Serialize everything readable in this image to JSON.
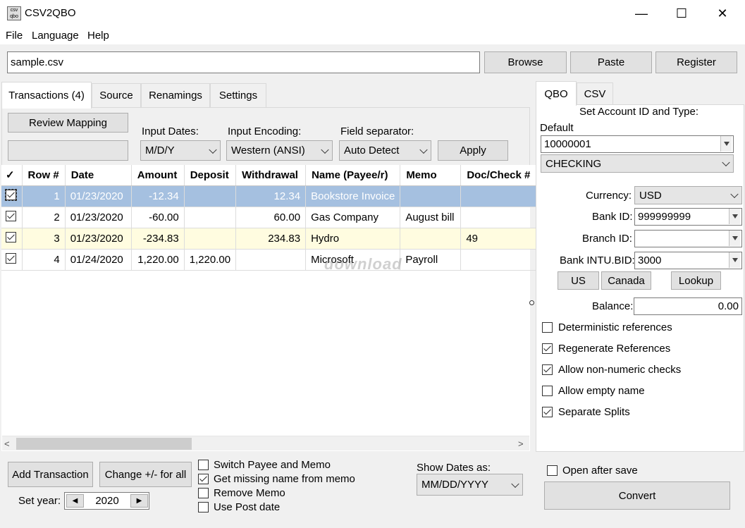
{
  "window": {
    "title": "CSV2QBO",
    "minimize": "—",
    "maximize": "☐",
    "close": "✕"
  },
  "menu": [
    "File",
    "Language",
    "Help"
  ],
  "file_path": "sample.csv",
  "toolbar": {
    "browse": "Browse",
    "paste": "Paste",
    "register": "Register"
  },
  "left_tabs": [
    "Transactions (4)",
    "Source",
    "Renamings",
    "Settings"
  ],
  "mapping": {
    "review_button": "Review Mapping",
    "mapping_select": "",
    "input_dates_label": "Input Dates:",
    "input_dates_value": "M/D/Y",
    "input_encoding_label": "Input Encoding:",
    "input_encoding_value": "Western (ANSI)",
    "field_separator_label": "Field separator:",
    "field_separator_value": "Auto Detect",
    "apply_button": "Apply"
  },
  "grid": {
    "headers": [
      "✓",
      "Row #",
      "Date",
      "Amount",
      "Deposit",
      "Withdrawal",
      "Name (Payee/r)",
      "Memo",
      "Doc/Check #"
    ],
    "rows": [
      {
        "checked": true,
        "row": "1",
        "date": "01/23/2020",
        "amount": "-12.34",
        "deposit": "",
        "withdrawal": "12.34",
        "name": "Bookstore Invoice",
        "memo": "",
        "doc": ""
      },
      {
        "checked": true,
        "row": "2",
        "date": "01/23/2020",
        "amount": "-60.00",
        "deposit": "",
        "withdrawal": "60.00",
        "name": "Gas Company",
        "memo": "August bill",
        "doc": ""
      },
      {
        "checked": true,
        "row": "3",
        "date": "01/23/2020",
        "amount": "-234.83",
        "deposit": "",
        "withdrawal": "234.83",
        "name": "Hydro",
        "memo": "",
        "doc": "49"
      },
      {
        "checked": true,
        "row": "4",
        "date": "01/24/2020",
        "amount": "1,220.00",
        "deposit": "1,220.00",
        "withdrawal": "",
        "name": "Microsoft",
        "memo": "Payroll",
        "doc": ""
      }
    ]
  },
  "bottom": {
    "add_transaction": "Add Transaction",
    "change_sign": "Change +/- for all",
    "set_year_label": "Set year:",
    "year_value": "2020",
    "options": [
      {
        "label": "Switch Payee and Memo",
        "checked": false
      },
      {
        "label": "Get missing name from memo",
        "checked": true
      },
      {
        "label": "Remove Memo",
        "checked": false
      },
      {
        "label": "Use Post date",
        "checked": false
      }
    ],
    "show_dates_label": "Show Dates as:",
    "show_dates_value": "MM/DD/YYYY"
  },
  "right_tabs": [
    "QBO",
    "CSV"
  ],
  "qbo": {
    "set_account_label": "Set Account ID and Type:",
    "default_label": "Default",
    "account_id": "10000001",
    "account_type": "CHECKING",
    "currency_label": "Currency:",
    "currency_value": "USD",
    "bank_id_label": "Bank ID:",
    "bank_id_value": "999999999",
    "branch_id_label": "Branch ID:",
    "branch_id_value": "",
    "bank_intu_label": "Bank INTU.BID:",
    "bank_intu_value": "3000",
    "us_button": "US",
    "canada_button": "Canada",
    "lookup_button": "Lookup",
    "balance_label": "Balance:",
    "balance_value": "0.00",
    "options": [
      {
        "label": "Deterministic references",
        "checked": false
      },
      {
        "label": "Regenerate References",
        "checked": true
      },
      {
        "label": "Allow non-numeric checks",
        "checked": true
      },
      {
        "label": "Allow empty name",
        "checked": false
      },
      {
        "label": "Separate Splits",
        "checked": true
      }
    ],
    "open_after_save_label": "Open after save",
    "open_after_save_checked": false,
    "convert_button": "Convert"
  },
  "watermark": "download"
}
